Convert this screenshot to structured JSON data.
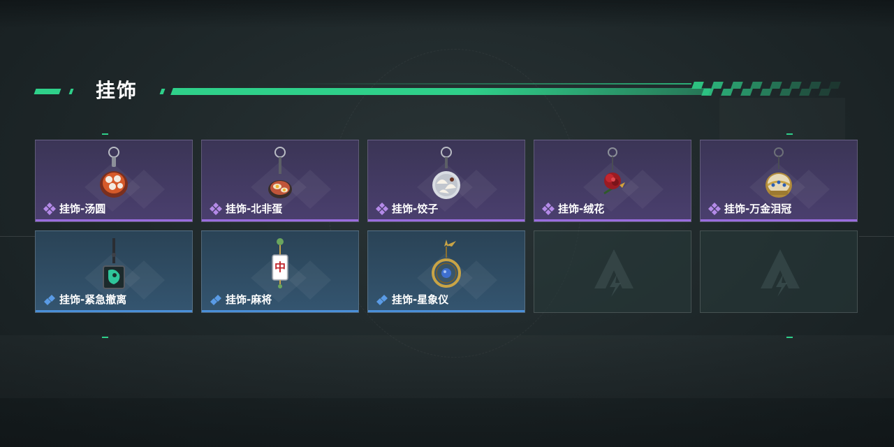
{
  "section": {
    "title": "挂饰"
  },
  "colors": {
    "accent": "#2fd08a",
    "rarity_purple": "#9a6de0",
    "rarity_blue": "#4a8fd8"
  },
  "cards": [
    {
      "label": "挂饰-汤圆",
      "rarity": "purple",
      "icon": "tangyuan-charm-icon"
    },
    {
      "label": "挂饰-北非蛋",
      "rarity": "purple",
      "icon": "shakshuka-charm-icon"
    },
    {
      "label": "挂饰-饺子",
      "rarity": "purple",
      "icon": "dumpling-charm-icon"
    },
    {
      "label": "挂饰-绒花",
      "rarity": "purple",
      "icon": "velvet-flower-charm-icon"
    },
    {
      "label": "挂饰-万金泪冠",
      "rarity": "purple",
      "icon": "crown-charm-icon"
    },
    {
      "label": "挂饰-紧急撤离",
      "rarity": "blue",
      "icon": "evacuation-charm-icon"
    },
    {
      "label": "挂饰-麻将",
      "rarity": "blue",
      "icon": "mahjong-charm-icon"
    },
    {
      "label": "挂饰-星象仪",
      "rarity": "blue",
      "icon": "astrolabe-charm-icon"
    },
    {
      "label": "",
      "rarity": "empty",
      "icon": "empty-slot-logo-icon"
    },
    {
      "label": "",
      "rarity": "empty",
      "icon": "empty-slot-logo-icon"
    }
  ]
}
